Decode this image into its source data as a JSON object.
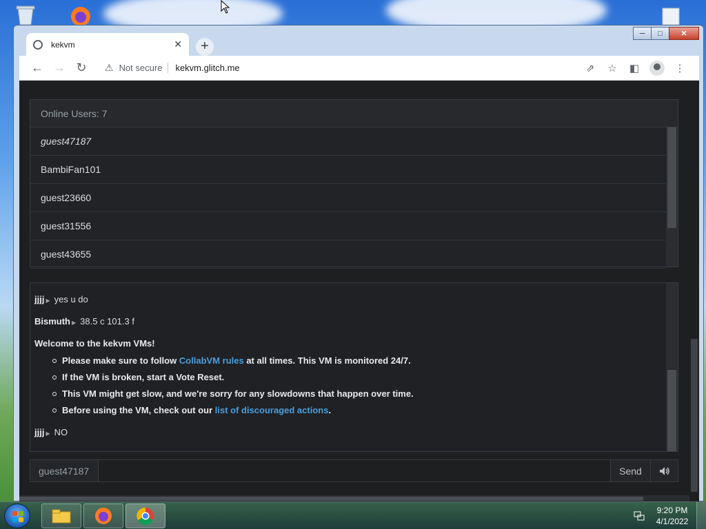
{
  "browser": {
    "tab_title": "kekvm",
    "security_label": "Not secure",
    "url": "kekvm.glitch.me",
    "window_controls": {
      "minimize_icon": "minimize-icon",
      "maximize_icon": "maximize-icon",
      "close_icon": "close-icon"
    }
  },
  "users": {
    "header": "Online Users: 7",
    "list": [
      "guest47187",
      "BambiFan101",
      "guest23660",
      "guest31556",
      "guest43655"
    ]
  },
  "chat": {
    "messages_top": [
      {
        "user": "jjjj",
        "text": "yes u do"
      },
      {
        "user": "Bismuth",
        "text": "38.5 c 101.3 f"
      }
    ],
    "welcome": "Welcome to the kekvm VMs!",
    "rules": {
      "r1_pre": "Please make sure to follow ",
      "r1_link": "CollabVM rules",
      "r1_post": " at all times. This VM is monitored 24/7.",
      "r2": "If the VM is broken, start a Vote Reset.",
      "r3": "This VM might get slow, and we're sorry for any slowdowns that happen over time.",
      "r4_pre": "Before using the VM, check out our ",
      "r4_link": "list of discouraged actions",
      "r4_post": "."
    },
    "messages_bottom": [
      {
        "user": "jjjj",
        "text": "NO"
      }
    ]
  },
  "input": {
    "nickname": "guest47187",
    "value": "",
    "send_label": "Send",
    "volume_icon": "speaker-icon"
  },
  "taskbar": {
    "time": "9:20 PM",
    "date": "4/1/2022"
  },
  "colors": {
    "page_bg": "#1d1f21",
    "link": "#4a9ede",
    "text": "#dadce0"
  }
}
